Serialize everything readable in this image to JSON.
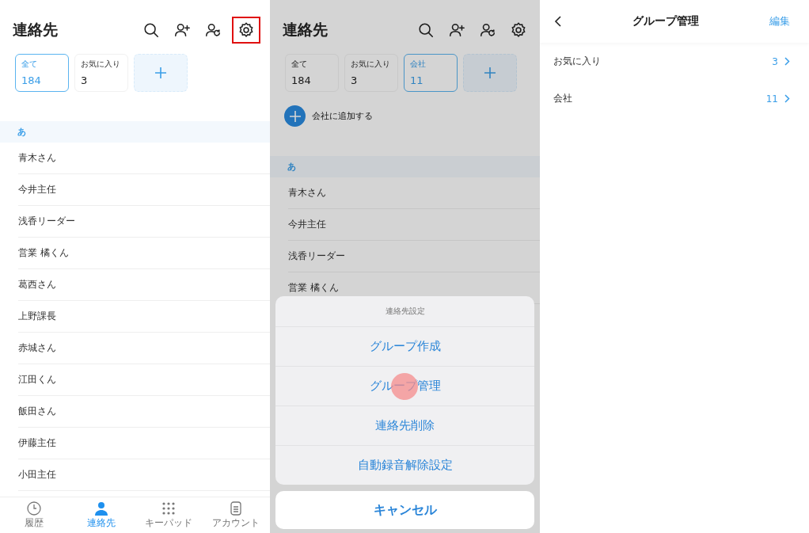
{
  "contacts_screen": {
    "title": "連絡先",
    "toolbar_icons": [
      {
        "kind": "search",
        "highlighted": false
      },
      {
        "kind": "add-person",
        "highlighted": false
      },
      {
        "kind": "sync-person",
        "highlighted": false
      },
      {
        "kind": "settings",
        "highlighted": true
      }
    ],
    "groups": [
      {
        "label": "全て",
        "count": "184",
        "selected": true
      },
      {
        "label": "お気に入り",
        "count": "3",
        "selected": false
      }
    ],
    "section": "あ",
    "contacts": [
      "青木さん",
      "今井主任",
      "浅香リーダー",
      "営業 橘くん",
      "葛西さん",
      "上野課長",
      "赤城さん",
      "江田くん",
      "飯田さん",
      "伊藤主任",
      "小田主任"
    ],
    "tab_bar": [
      {
        "kind": "history",
        "label": "履歴",
        "selected": false
      },
      {
        "kind": "contacts",
        "label": "連絡先",
        "selected": true
      },
      {
        "kind": "keypad",
        "label": "キーパッド",
        "selected": false
      },
      {
        "kind": "account",
        "label": "アカウント",
        "selected": false
      }
    ]
  },
  "sheet_screen": {
    "title": "連絡先",
    "toolbar_icons": [
      {
        "kind": "search"
      },
      {
        "kind": "add-person"
      },
      {
        "kind": "sync-person"
      },
      {
        "kind": "settings"
      }
    ],
    "groups": [
      {
        "label": "全て",
        "count": "184",
        "selected": false
      },
      {
        "label": "お気に入り",
        "count": "3",
        "selected": false
      },
      {
        "label": "会社",
        "count": "11",
        "selected": true
      }
    ],
    "add_to_group": "会社に追加する",
    "section": "あ",
    "contacts": [
      "青木さん",
      "今井主任",
      "浅香リーダー",
      "営業 橘くん"
    ],
    "sheet": {
      "title": "連絡先設定",
      "items": [
        {
          "label": "グループ作成",
          "tapped": false
        },
        {
          "label": "グループ管理",
          "tapped": true
        },
        {
          "label": "連絡先削除",
          "tapped": false
        },
        {
          "label": "自動録音解除設定",
          "tapped": false
        }
      ],
      "cancel": "キャンセル"
    }
  },
  "group_screen": {
    "title": "グループ管理",
    "edit": "編集",
    "groups": [
      {
        "name": "お気に入り",
        "count": "3"
      },
      {
        "name": "会社",
        "count": "11"
      }
    ]
  }
}
